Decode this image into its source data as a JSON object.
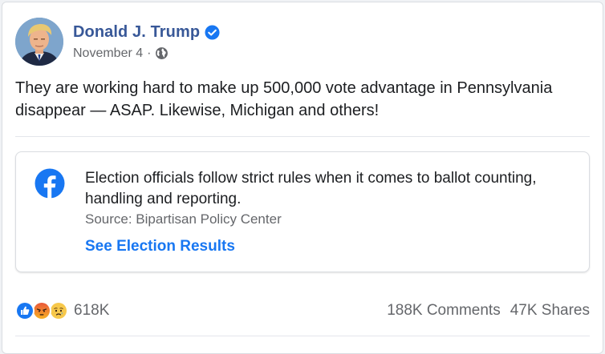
{
  "post": {
    "author": "Donald J. Trump",
    "verified": true,
    "date": "November 4",
    "separator": "·",
    "privacy_icon": "globe-icon",
    "text": "They are working hard to make up 500,000 vote advantage in Pennsylvania disappear — ASAP. Likewise, Michigan and others!"
  },
  "info_card": {
    "icon": "facebook-logo-icon",
    "text": "Election officials follow strict rules when it comes to ballot counting, handling and reporting.",
    "source": "Source: Bipartisan Policy Center",
    "link_label": "See Election Results"
  },
  "footer": {
    "reactions": [
      "like-reaction-icon",
      "angry-reaction-icon",
      "sad-reaction-icon"
    ],
    "reaction_count": "618K",
    "comments": "188K Comments",
    "shares": "47K Shares"
  },
  "colors": {
    "name": "#385898",
    "link": "#1877f2",
    "verified": "#1877f2",
    "meta_text": "#65676b",
    "body_text": "#1c1e21"
  }
}
